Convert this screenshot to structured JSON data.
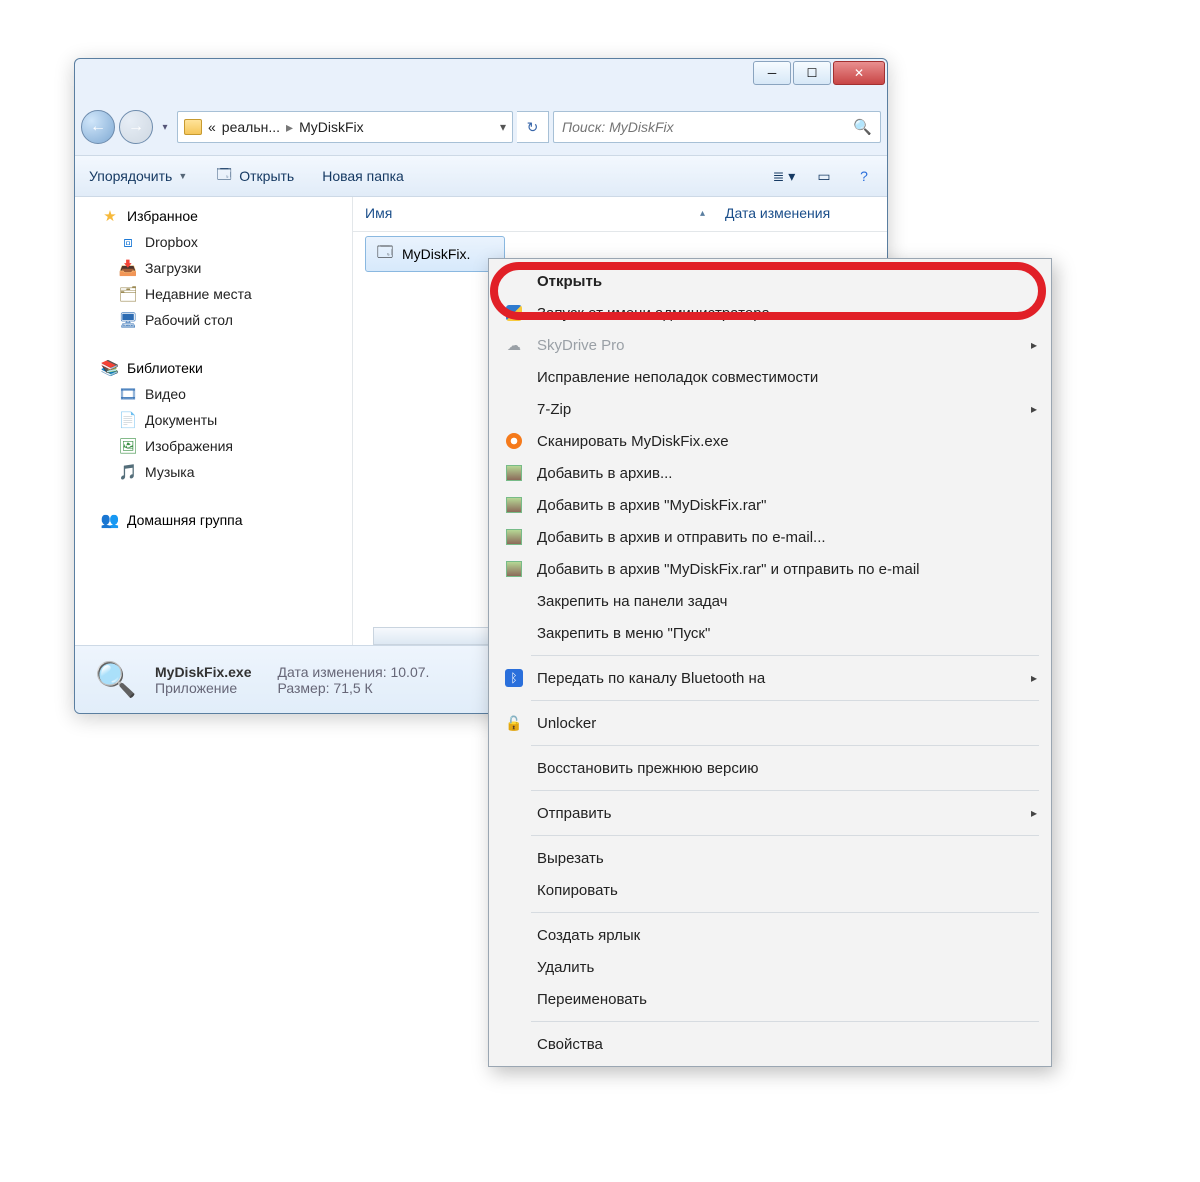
{
  "breadcrumb": {
    "prefix": "«",
    "segment1": "реальн...",
    "segment2": "MyDiskFix"
  },
  "search": {
    "placeholder": "Поиск: MyDiskFix"
  },
  "toolbar": {
    "organize": "Упорядочить",
    "open": "Открыть",
    "newfolder": "Новая папка"
  },
  "sidebar": {
    "favorites": "Избранное",
    "fav_items": [
      "Dropbox",
      "Загрузки",
      "Недавние места",
      "Рабочий стол"
    ],
    "libraries": "Библиотеки",
    "lib_items": [
      "Видео",
      "Документы",
      "Изображения",
      "Музыка"
    ],
    "homegroup": "Домашняя группа"
  },
  "columns": {
    "name": "Имя",
    "date": "Дата изменения"
  },
  "file": {
    "name": "MyDiskFix."
  },
  "details": {
    "filename": "MyDiskFix.exe",
    "type": "Приложение",
    "date_label": "Дата изменения:",
    "date_value": "10.07.",
    "size_label": "Размер:",
    "size_value": "71,5 К"
  },
  "ctx": {
    "open": "Открыть",
    "runas": "Запуск от имени администратора",
    "skydrive": "SkyDrive Pro",
    "compat": "Исправление неполадок совместимости",
    "sevenzip": "7-Zip",
    "scan": "Сканировать MyDiskFix.exe",
    "addarchive": "Добавить в архив...",
    "addrar": "Добавить в архив \"MyDiskFix.rar\"",
    "addmail": "Добавить в архив и отправить по e-mail...",
    "addrarmail": "Добавить в архив \"MyDiskFix.rar\" и отправить по e-mail",
    "pintaskbar": "Закрепить на панели задач",
    "pinstart": "Закрепить в меню \"Пуск\"",
    "bluetooth": "Передать по каналу Bluetooth на",
    "unlocker": "Unlocker",
    "restore": "Восстановить прежнюю версию",
    "sendto": "Отправить",
    "cut": "Вырезать",
    "copy": "Копировать",
    "shortcut": "Создать ярлык",
    "delete": "Удалить",
    "rename": "Переименовать",
    "properties": "Свойства"
  }
}
